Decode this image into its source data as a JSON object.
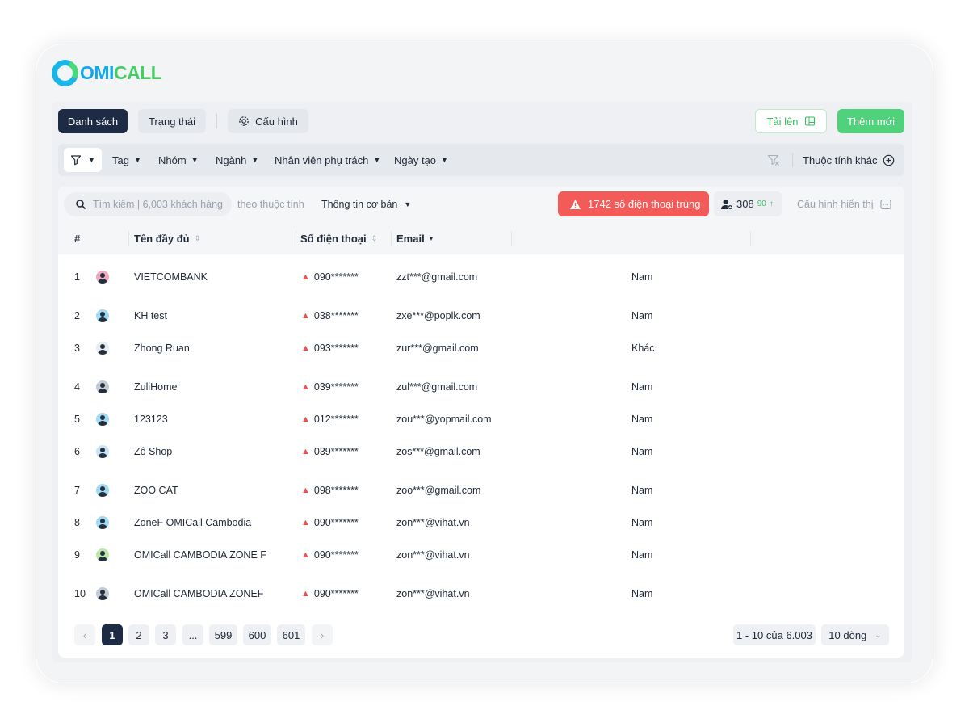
{
  "brand": {
    "prefix": "OMI",
    "suffix": "CALL"
  },
  "toolbar": {
    "tab_list": "Danh sách",
    "tab_status": "Trạng thái",
    "config": "Cấu hình",
    "upload": "Tải lên",
    "add_new": "Thêm mới"
  },
  "filters": {
    "tag": "Tag",
    "group": "Nhóm",
    "industry": "Ngành",
    "staff": "Nhân viên phụ trách",
    "created": "Ngày tạo",
    "other": "Thuộc tính khác"
  },
  "search": {
    "placeholder": "Tìm kiếm | 6,003 khách hàng",
    "by_attr": "theo thuộc tính",
    "info_select": "Thông tin cơ bản"
  },
  "duplicates": "1742 số điện thoại trùng",
  "user_count": {
    "value": "308",
    "delta": "90"
  },
  "display_config": "Cấu hình hiển thị",
  "columns": {
    "index": "#",
    "name": "Tên đầy đủ",
    "phone": "Số điện thoại",
    "email": "Email"
  },
  "rows": [
    {
      "no": "1",
      "name": "VIETCOMBANK",
      "phone": "090*******",
      "email": "zzt***@gmail.com",
      "gender": "Nam"
    },
    {
      "no": "2",
      "name": "KH test",
      "phone": "038*******",
      "email": "zxe***@poplk.com",
      "gender": "Nam"
    },
    {
      "no": "3",
      "name": "Zhong Ruan",
      "phone": "093*******",
      "email": "zur***@gmail.com",
      "gender": "Khác"
    },
    {
      "no": "4",
      "name": "ZuliHome",
      "phone": "039*******",
      "email": "zul***@gmail.com",
      "gender": "Nam"
    },
    {
      "no": "5",
      "name": "123123",
      "phone": "012*******",
      "email": "zou***@yopmail.com",
      "gender": "Nam"
    },
    {
      "no": "6",
      "name": "Zô Shop",
      "phone": "039*******",
      "email": "zos***@gmail.com",
      "gender": "Nam"
    },
    {
      "no": "7",
      "name": "ZOO CAT",
      "phone": "098*******",
      "email": "zoo***@gmail.com",
      "gender": "Nam"
    },
    {
      "no": "8",
      "name": "ZoneF OMICall Cambodia",
      "phone": "090*******",
      "email": "zon***@vihat.vn",
      "gender": "Nam"
    },
    {
      "no": "9",
      "name": "OMICall CAMBODIA ZONE F",
      "phone": "090*******",
      "email": "zon***@vihat.vn",
      "gender": "Nam"
    },
    {
      "no": "10",
      "name": "OMICall CAMBODIA ZONEF",
      "phone": "090*******",
      "email": "zon***@vihat.vn",
      "gender": "Nam"
    }
  ],
  "pagination": {
    "pages": [
      "1",
      "2",
      "3",
      "...",
      "599",
      "600",
      "601"
    ],
    "range": "1 - 10 của 6.003",
    "page_size": "10 dòng"
  },
  "colors": {
    "accent_dark": "#1e2b45",
    "green": "#4fd27b",
    "danger": "#f25b57"
  }
}
